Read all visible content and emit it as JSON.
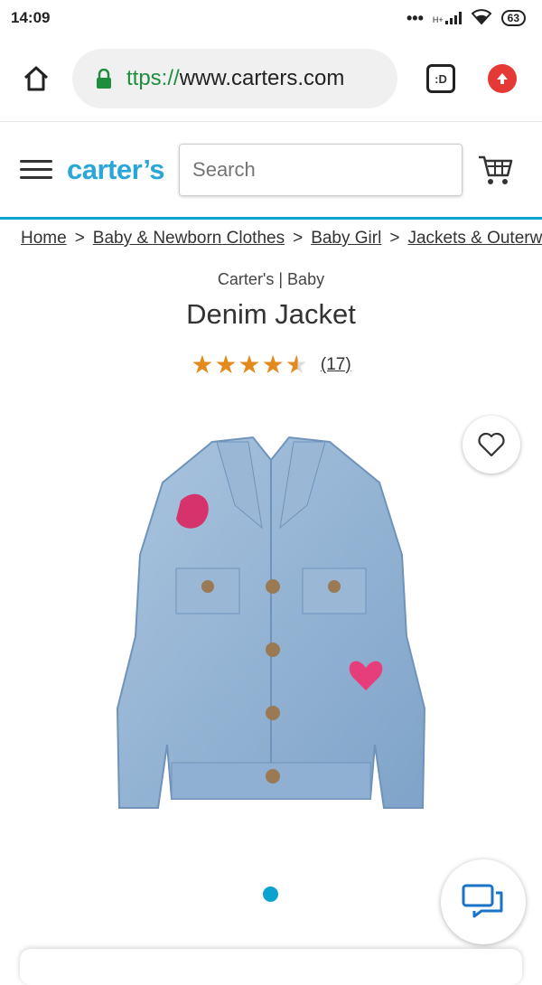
{
  "status_bar": {
    "time": "14:09",
    "signal": "H+",
    "battery": "63"
  },
  "browser": {
    "url_scheme": "ttps://",
    "url_host": "www.carters.com",
    "tabs_label": ":D"
  },
  "site": {
    "logo": "carter’s",
    "search_placeholder": "Search"
  },
  "breadcrumb": {
    "items": [
      "Home",
      "Baby & Newborn Clothes",
      "Baby Girl",
      "Jackets & Outerwear"
    ],
    "separator": ">"
  },
  "product": {
    "brand": "Carter's | Baby",
    "title": "Denim Jacket",
    "rating": 4.6,
    "review_count": "(17)"
  },
  "colors": {
    "accent": "#0aa3cf",
    "logo": "#2aa6d8",
    "star": "#e48a1c",
    "url_green": "#1e8e3e"
  }
}
